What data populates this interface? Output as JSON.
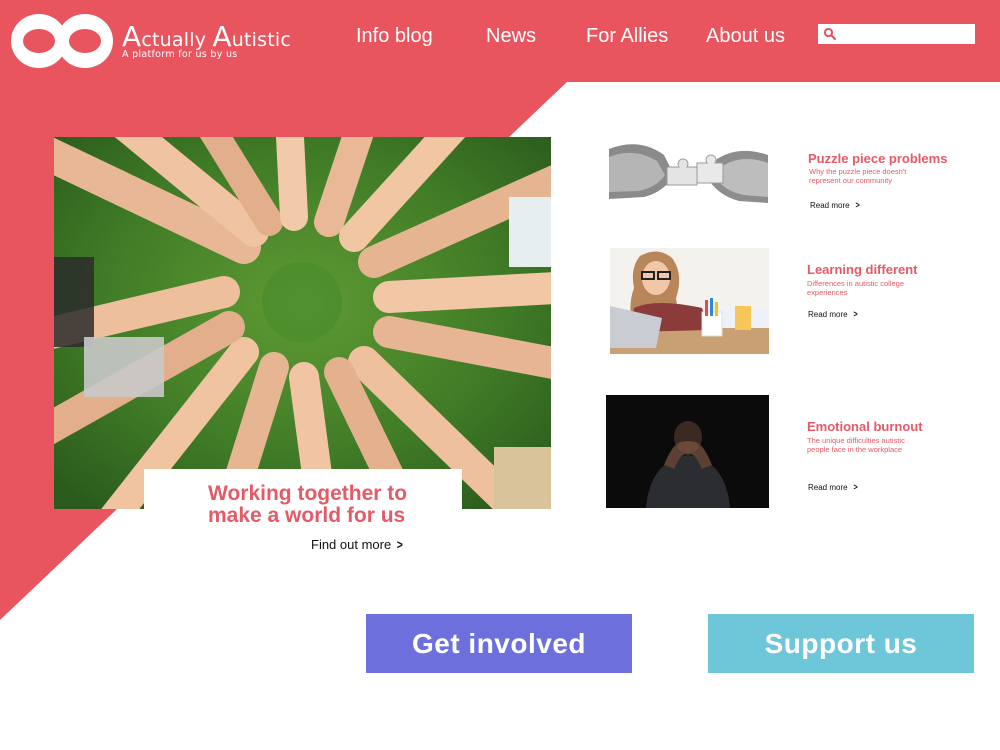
{
  "colors": {
    "brand": "#e8555f",
    "accent_text": "#e45a67",
    "get_involved_bg": "#6c6fdc",
    "support_bg": "#6ec6d9"
  },
  "header": {
    "title_first_initial": "A",
    "title_first_rest": "ctually",
    "title_second_initial": "A",
    "title_second_rest": "utistic",
    "tagline": "A platform for us by us",
    "logo_icon": "infinity-icon",
    "nav": [
      {
        "label": "Info blog"
      },
      {
        "label": "News"
      },
      {
        "label": "For Allies"
      },
      {
        "label": "About us"
      }
    ],
    "search": {
      "placeholder": "",
      "icon": "search-icon"
    }
  },
  "hero": {
    "title": "Working together to make a world for us",
    "link_label": "Find out more",
    "image": "hands-in-circle-on-grass"
  },
  "articles": [
    {
      "title": "Puzzle piece problems",
      "description": "Why the puzzle piece doesn't represent our community",
      "link_label": "Read more",
      "image": "hands-holding-puzzle-pieces"
    },
    {
      "title": "Learning different",
      "description": "Differences in autistic college experiences",
      "link_label": "Read more",
      "image": "student-at-laptop"
    },
    {
      "title": "Emotional burnout",
      "description": "The unique difficulties autistic people face in the workplace",
      "link_label": "Read more",
      "image": "man-head-in-hands"
    }
  ],
  "cta": {
    "get_involved": "Get involved",
    "support": "Support us"
  }
}
